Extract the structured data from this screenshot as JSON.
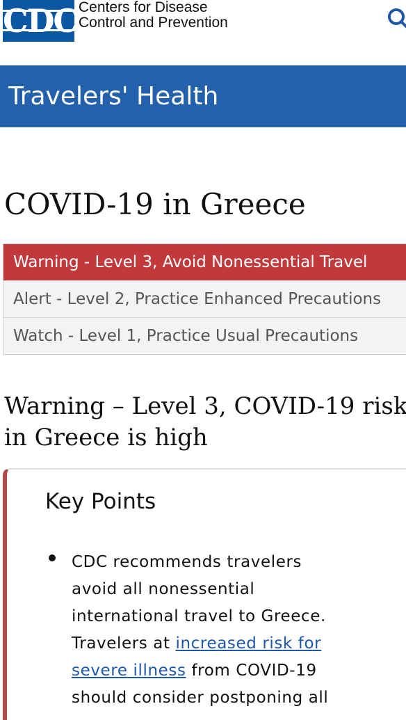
{
  "header": {
    "logo_text": "CDC",
    "org_line1": "Centers for Disease",
    "org_line2": "Control and Prevention"
  },
  "banner": {
    "title": "Travelers' Health"
  },
  "page_title": "COVID-19 in Greece",
  "levels": [
    {
      "label": "Warning - Level 3, Avoid Nonessential Travel",
      "active": true
    },
    {
      "label": "Alert - Level 2, Practice Enhanced Precautions",
      "active": false
    },
    {
      "label": "Watch - Level 1, Practice Usual Precautions",
      "active": false
    }
  ],
  "warning_heading": {
    "line1": "Warning – Level 3, COVID-19 risk",
    "line2": "in Greece is high"
  },
  "key_points": {
    "title": "Key Points",
    "line1": "CDC recommends travelers",
    "line2": "avoid all nonessential",
    "line3": "international travel to Greece.",
    "line4_pre": "Travelers at ",
    "link_part1": "increased risk for",
    "link_part2": "severe illness",
    "line5_post": " from COVID-19",
    "line6": "should consider postponing all"
  },
  "colors": {
    "banner": "#2461ad",
    "logo": "#0b57a4",
    "warning": "#c1393a",
    "link": "#1f58a8"
  }
}
